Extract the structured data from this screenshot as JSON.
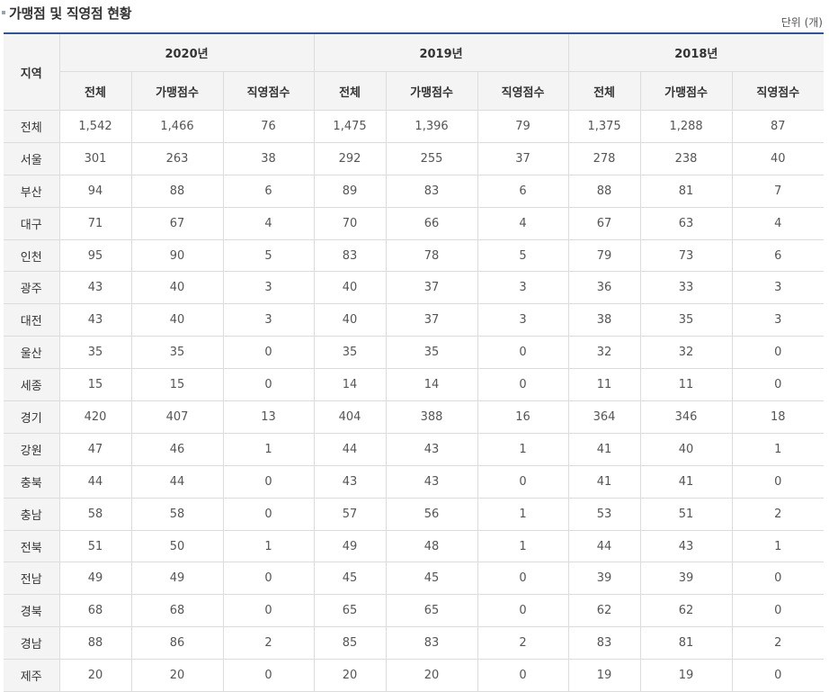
{
  "title": "가맹점 및 직영점 현황",
  "unit": "단위 (개)",
  "table": {
    "region_header": "지역",
    "years": [
      "2020년",
      "2019년",
      "2018년"
    ],
    "sub_headers": [
      "전체",
      "가맹점수",
      "직영점수"
    ],
    "rows": [
      [
        "전체",
        "1,542",
        "1,466",
        "76",
        "1,475",
        "1,396",
        "79",
        "1,375",
        "1,288",
        "87"
      ],
      [
        "서울",
        "301",
        "263",
        "38",
        "292",
        "255",
        "37",
        "278",
        "238",
        "40"
      ],
      [
        "부산",
        "94",
        "88",
        "6",
        "89",
        "83",
        "6",
        "88",
        "81",
        "7"
      ],
      [
        "대구",
        "71",
        "67",
        "4",
        "70",
        "66",
        "4",
        "67",
        "63",
        "4"
      ],
      [
        "인천",
        "95",
        "90",
        "5",
        "83",
        "78",
        "5",
        "79",
        "73",
        "6"
      ],
      [
        "광주",
        "43",
        "40",
        "3",
        "40",
        "37",
        "3",
        "36",
        "33",
        "3"
      ],
      [
        "대전",
        "43",
        "40",
        "3",
        "40",
        "37",
        "3",
        "38",
        "35",
        "3"
      ],
      [
        "울산",
        "35",
        "35",
        "0",
        "35",
        "35",
        "0",
        "32",
        "32",
        "0"
      ],
      [
        "세종",
        "15",
        "15",
        "0",
        "14",
        "14",
        "0",
        "11",
        "11",
        "0"
      ],
      [
        "경기",
        "420",
        "407",
        "13",
        "404",
        "388",
        "16",
        "364",
        "346",
        "18"
      ],
      [
        "강원",
        "47",
        "46",
        "1",
        "44",
        "43",
        "1",
        "41",
        "40",
        "1"
      ],
      [
        "충북",
        "44",
        "44",
        "0",
        "43",
        "43",
        "0",
        "41",
        "41",
        "0"
      ],
      [
        "충남",
        "58",
        "58",
        "0",
        "57",
        "56",
        "1",
        "53",
        "51",
        "2"
      ],
      [
        "전북",
        "51",
        "50",
        "1",
        "49",
        "48",
        "1",
        "44",
        "43",
        "1"
      ],
      [
        "전남",
        "49",
        "49",
        "0",
        "45",
        "45",
        "0",
        "39",
        "39",
        "0"
      ],
      [
        "경북",
        "68",
        "68",
        "0",
        "65",
        "65",
        "0",
        "62",
        "62",
        "0"
      ],
      [
        "경남",
        "88",
        "86",
        "2",
        "85",
        "83",
        "2",
        "83",
        "81",
        "2"
      ],
      [
        "제주",
        "20",
        "20",
        "0",
        "20",
        "20",
        "0",
        "19",
        "19",
        "0"
      ]
    ]
  }
}
